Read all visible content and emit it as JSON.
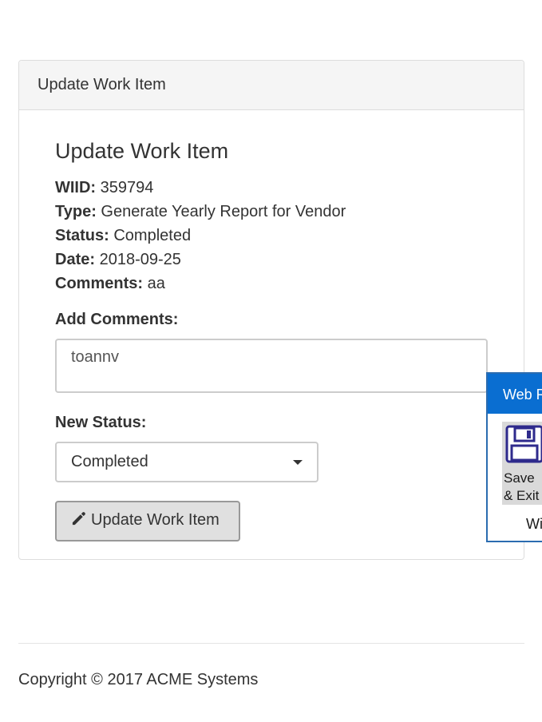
{
  "panel": {
    "heading": "Update Work Item"
  },
  "form": {
    "title": "Update Work Item",
    "fields": [
      {
        "label": "WIID:",
        "value": "359794"
      },
      {
        "label": "Type:",
        "value": "Generate Yearly Report for Vendor"
      },
      {
        "label": "Status:",
        "value": "Completed"
      },
      {
        "label": "Date:",
        "value": "2018-09-25"
      },
      {
        "label": "Comments:",
        "value": "aa"
      }
    ],
    "add_comments_label": "Add Comments:",
    "add_comments_value": "toannv",
    "new_status_label": "New Status:",
    "new_status_value": "Completed",
    "submit_label": "Update Work Item"
  },
  "footer": {
    "copyright": "Copyright © 2017 ACME Systems"
  },
  "recorder": {
    "title": "Web R",
    "save_label": "Save\n& Exit",
    "bottom_text": "Wi",
    "accent_color": "#0a6ed1"
  }
}
